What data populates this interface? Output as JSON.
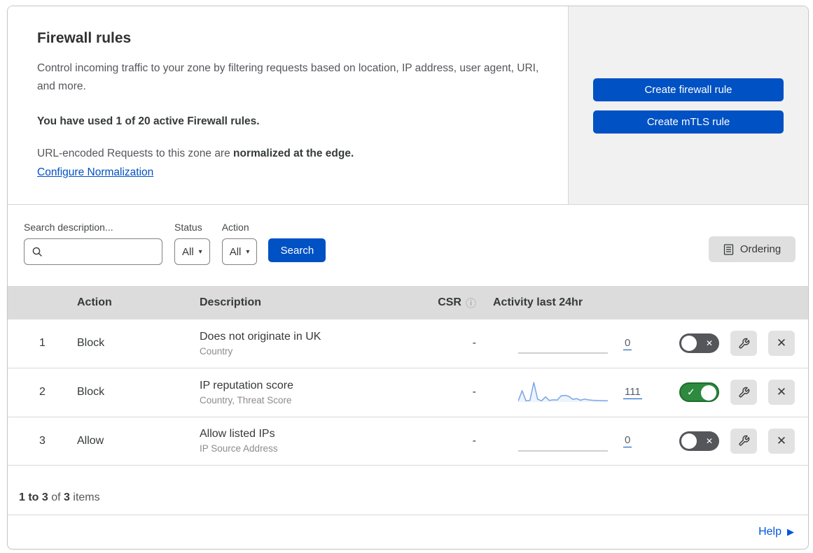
{
  "header": {
    "title": "Firewall rules",
    "description": "Control incoming traffic to your zone by filtering requests based on location, IP address, user agent, URI, and more.",
    "usage": "You have used 1 of 20 active Firewall rules.",
    "normalization_prefix": "URL-encoded Requests to this zone are ",
    "normalization_bold": "normalized at the edge.",
    "normalization_link": "Configure Normalization",
    "create_firewall_rule_label": "Create firewall rule",
    "create_mtls_rule_label": "Create mTLS rule"
  },
  "filters": {
    "search_label": "Search description...",
    "status_label": "Status",
    "status_value": "All",
    "action_label": "Action",
    "action_value": "All",
    "search_button_label": "Search",
    "ordering_button_label": "Ordering"
  },
  "table": {
    "columns": {
      "action": "Action",
      "description": "Description",
      "csr": "CSR",
      "activity": "Activity last 24hr"
    },
    "rows": [
      {
        "priority": "1",
        "action": "Block",
        "description": "Does not originate in UK",
        "criteria": "Country",
        "csr": "-",
        "activity_count": "0",
        "enabled": false,
        "sparkline": null
      },
      {
        "priority": "2",
        "action": "Block",
        "description": "IP reputation score",
        "criteria": "Country, Threat Score",
        "csr": "-",
        "activity_count": "111",
        "enabled": true,
        "sparkline": [
          5,
          58,
          6,
          8,
          100,
          14,
          6,
          26,
          8,
          11,
          10,
          31,
          34,
          29,
          14,
          17,
          9,
          15,
          11,
          9,
          8,
          7,
          7,
          6
        ]
      },
      {
        "priority": "3",
        "action": "Allow",
        "description": "Allow listed IPs",
        "criteria": "IP Source Address",
        "csr": "-",
        "activity_count": "0",
        "enabled": false,
        "sparkline": null
      }
    ]
  },
  "footer": {
    "range": "1 to 3",
    "of_text": " of ",
    "total": "3",
    "items_text": " items"
  },
  "help": {
    "label": "Help"
  },
  "colors": {
    "accent_blue": "#0051c3",
    "help_blue": "#0055dc",
    "toggle_on_green": "#2e8a3e",
    "toggle_off_gray": "#54565a",
    "sparkline_blue": "#7aa5e9",
    "table_header_gray": "#dcdcdc",
    "side_panel_gray": "#f1f1f1"
  }
}
